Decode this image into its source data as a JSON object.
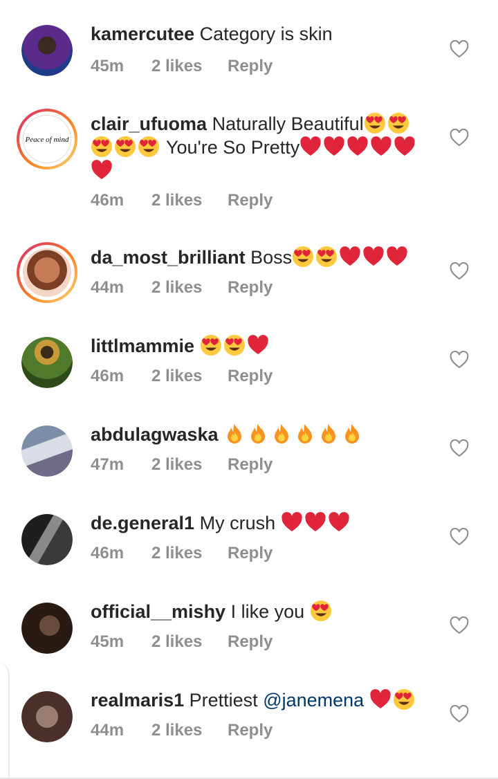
{
  "actions": {
    "like_icon": "heart-outline-icon",
    "reply_label": "Reply"
  },
  "comments": [
    {
      "username": "kamercutee",
      "text": "Category is skin",
      "emojis": [],
      "time": "45m",
      "likes": "2 likes",
      "reply": "Reply",
      "avatar": {
        "style": "plain",
        "colors": [
          "#5a2b8a",
          "#1e3c8a"
        ]
      }
    },
    {
      "username": "clair_ufuoma",
      "text": "Naturally Beautiful",
      "emojis": [
        "heart-eyes",
        "heart-eyes"
      ],
      "text2": " You're So Pretty",
      "emojis_pre2": [
        "heart-eyes",
        "heart-eyes",
        "heart-eyes"
      ],
      "emojis2": [
        "red-heart",
        "red-heart",
        "red-heart",
        "red-heart",
        "red-heart",
        "red-heart"
      ],
      "time": "46m",
      "likes": "2 likes",
      "reply": "Reply",
      "avatar": {
        "style": "ring",
        "label": "Peace of mind"
      }
    },
    {
      "username": "da_most_brilliant",
      "text": "Boss",
      "emojis": [
        "heart-eyes",
        "heart-eyes",
        "red-heart",
        "red-heart",
        "red-heart"
      ],
      "time": "44m",
      "likes": "2 likes",
      "reply": "Reply",
      "avatar": {
        "style": "ring",
        "colors": [
          "#c77b56",
          "#7a3f24"
        ]
      }
    },
    {
      "username": "littlmammie",
      "text": "",
      "emojis": [
        "heart-eyes",
        "heart-eyes",
        "red-heart"
      ],
      "time": "46m",
      "likes": "2 likes",
      "reply": "Reply",
      "avatar": {
        "style": "plain",
        "colors": [
          "#4f7a2c",
          "#2d4a18"
        ]
      }
    },
    {
      "username": "abdulagwaska",
      "text": "",
      "emojis": [
        "fire",
        "fire",
        "fire",
        "fire",
        "fire",
        "fire"
      ],
      "time": "47m",
      "likes": "2 likes",
      "reply": "Reply",
      "avatar": {
        "style": "plain",
        "colors": [
          "#7d8fa8",
          "#d8dde6"
        ]
      }
    },
    {
      "username": "de.general1",
      "text": "My crush",
      "emojis": [
        "red-heart",
        "red-heart",
        "red-heart"
      ],
      "time": "46m",
      "likes": "2 likes",
      "reply": "Reply",
      "avatar": {
        "style": "plain",
        "colors": [
          "#3a3a3a",
          "#8a8a8a"
        ]
      }
    },
    {
      "username": "official__mishy",
      "text": "I like you",
      "emojis": [
        "heart-eyes"
      ],
      "time": "45m",
      "likes": "2 likes",
      "reply": "Reply",
      "avatar": {
        "style": "plain",
        "colors": [
          "#2a1a14",
          "#6a4a3a"
        ]
      }
    },
    {
      "username": "realmaris1",
      "text": "Prettiest",
      "mention": "@janemena",
      "emojis": [
        "red-heart",
        "heart-eyes"
      ],
      "time": "44m",
      "likes": "2 likes",
      "reply": "Reply",
      "avatar": {
        "style": "plain",
        "colors": [
          "#4a3028",
          "#9a7c70"
        ]
      }
    }
  ],
  "colors": {
    "meta": "#8e8e8e",
    "mention": "#00376b",
    "heart": "#e0243a",
    "emoji_face": "#ffc83d"
  }
}
